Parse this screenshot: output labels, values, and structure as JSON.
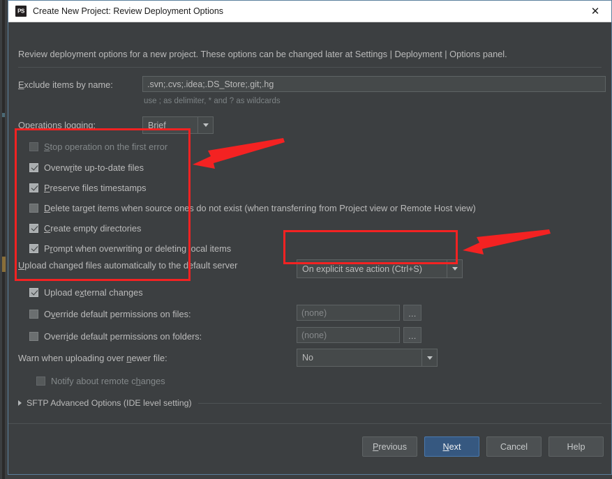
{
  "window": {
    "title": "Create New Project: Review Deployment Options",
    "app_icon": "phpstorm-icon",
    "close_icon": "✕"
  },
  "intro": {
    "text": "Review deployment options for a new project. These options can be changed later at Settings | Deployment | Options panel."
  },
  "exclude": {
    "label_pre": "E",
    "label_post": "xclude items by name:",
    "value": ".svn;.cvs;.idea;.DS_Store;.git;.hg",
    "hint": "use ; as delimiter, * and ? as wildcards"
  },
  "operations_logging": {
    "label_pre": "O",
    "label_post": "perations logging:",
    "value": "Brief"
  },
  "checkboxes": [
    {
      "name": "stop-operation-on-first-error",
      "mn": "S",
      "rest": "top operation on the first error",
      "checked": false,
      "dim": true
    },
    {
      "name": "overwrite-up-to-date-files",
      "pre": "Overw",
      "mn": "r",
      "rest": "ite up-to-date files",
      "checked": true,
      "dim": false
    },
    {
      "name": "preserve-files-timestamps",
      "mn": "P",
      "rest": "reserve files timestamps",
      "checked": true,
      "dim": false
    },
    {
      "name": "delete-target-items",
      "mn": "D",
      "rest": "elete target items when source ones do not exist (when transferring from Project view or Remote Host view)",
      "checked": false,
      "dim": false
    },
    {
      "name": "create-empty-directories",
      "mn": "C",
      "rest": "reate empty directories",
      "checked": true,
      "dim": false
    },
    {
      "name": "prompt-when-overwriting",
      "pre": "P",
      "mn": "r",
      "rest": "ompt when overwriting or deleting local items",
      "checked": true,
      "dim": false
    },
    {
      "name": "upload-external-changes",
      "pre": "Upload e",
      "mn": "x",
      "rest": "ternal changes",
      "checked": true,
      "dim": false
    }
  ],
  "upload_auto": {
    "label_mn": "U",
    "label_rest": "pload changed files automatically to the default server",
    "value": "On explicit save action (Ctrl+S)"
  },
  "override_files": {
    "label_pre": "O",
    "label_mn": "v",
    "label_rest": "erride default permissions on files:",
    "checked": false,
    "value": "(none)",
    "browse": "…"
  },
  "override_folders": {
    "label_pre": "Overr",
    "label_mn": "i",
    "label_rest": "de default permissions on folders:",
    "checked": false,
    "value": "(none)",
    "browse": "…"
  },
  "warn_newer": {
    "label_pre": "Warn when uploading over ",
    "label_mn": "n",
    "label_rest": "ewer file:",
    "value": "No"
  },
  "notify_remote": {
    "label_pre": "Notify about remote c",
    "label_mn": "h",
    "label_rest": "anges",
    "checked": false
  },
  "sftp_advanced": {
    "label": "SFTP Advanced Options (IDE level setting)",
    "expanded": false
  },
  "buttons": [
    {
      "name": "previous-button",
      "pre": "",
      "mn": "P",
      "rest": "revious",
      "default": false
    },
    {
      "name": "next-button",
      "pre": "",
      "mn": "N",
      "rest": "ext",
      "default": true
    },
    {
      "name": "cancel-button",
      "pre": "Cancel",
      "mn": "",
      "rest": "",
      "default": false
    },
    {
      "name": "help-button",
      "pre": "Help",
      "mn": "",
      "rest": "",
      "default": false
    }
  ],
  "annotations": {
    "color": "#f42222",
    "box_options": "highlight-rectangle-options-checkboxes",
    "box_dropdown": "highlight-rectangle-upload-dropdown",
    "arrow_options": "arrow-pointing-to-options-checkboxes",
    "arrow_dropdown": "arrow-pointing-to-upload-dropdown"
  }
}
